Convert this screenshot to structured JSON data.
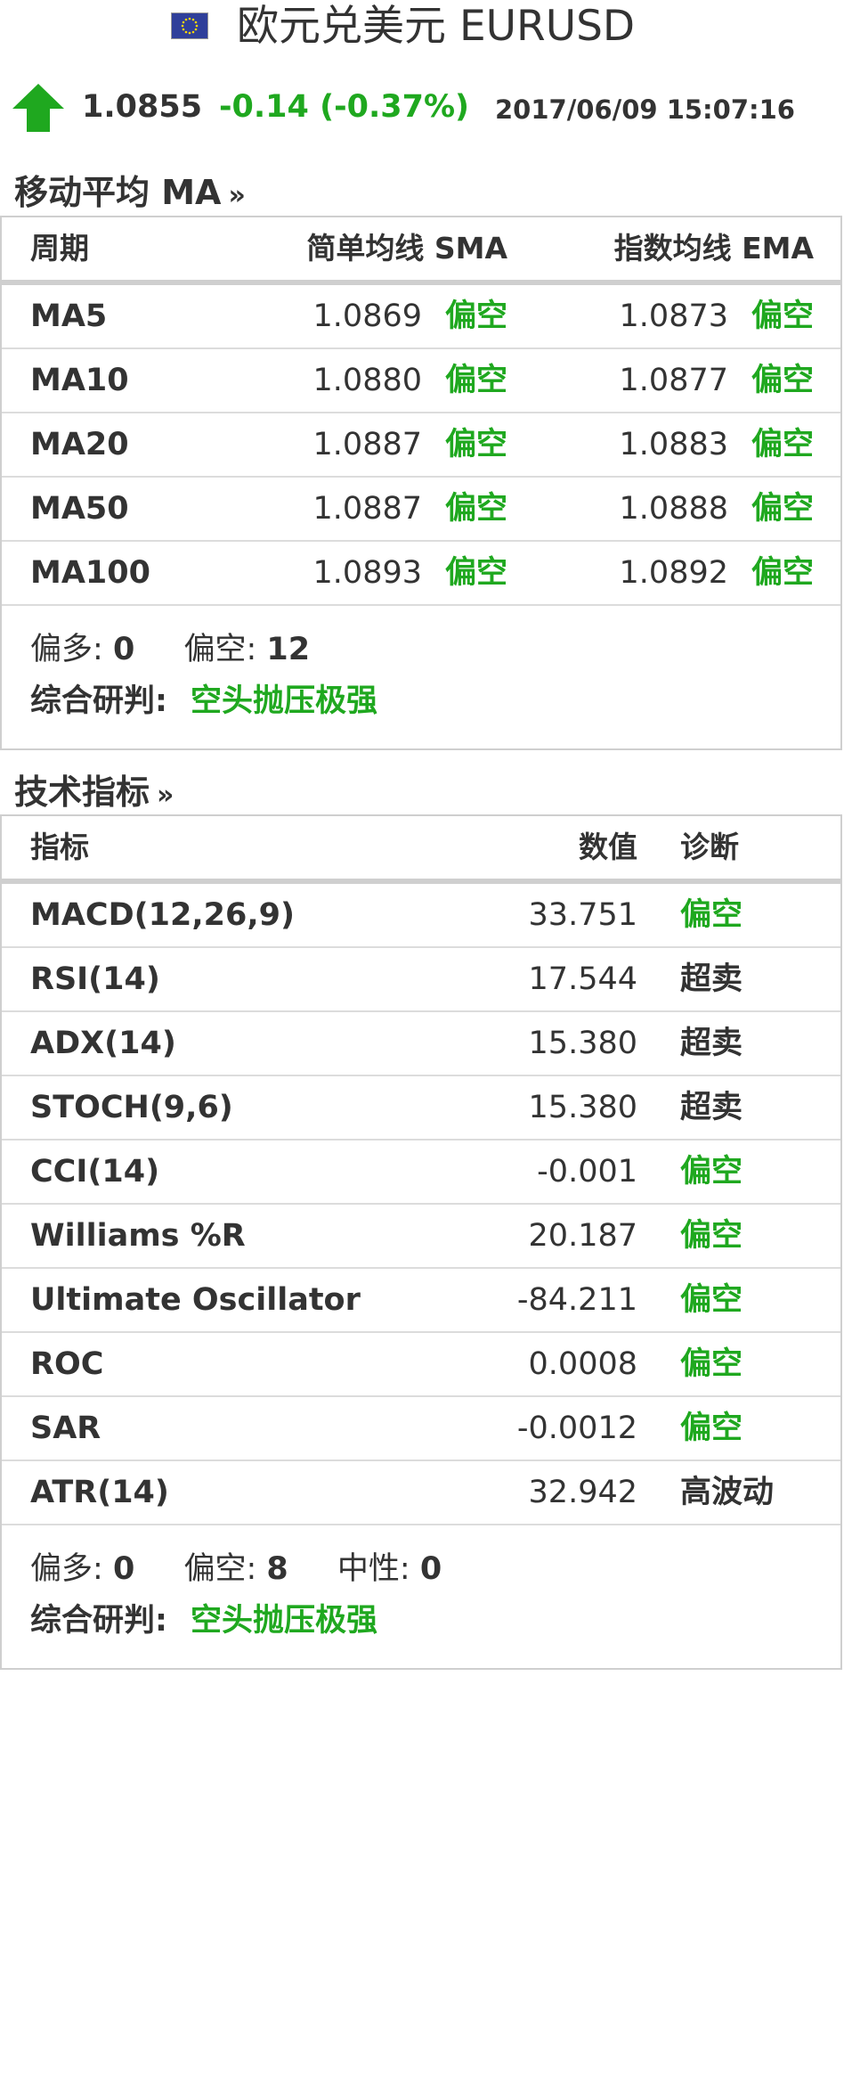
{
  "header": {
    "title": "欧元兑美元 EURUSD",
    "flag_icon": "eu-flag-icon"
  },
  "quote": {
    "trend_icon": "arrow-up-icon",
    "price": "1.0855",
    "change": "-0.14 (-0.37%)",
    "timestamp": "2017/06/09 15:07:16"
  },
  "colors": {
    "bullish_up_arrow": "#1fa81f",
    "text": "#333333",
    "border": "#cfcfcf"
  },
  "ma": {
    "section_title": "移动平均 MA",
    "more_icon": "»",
    "headers": {
      "period": "周期",
      "sma": "简单均线 SMA",
      "ema": "指数均线 EMA"
    },
    "rows": [
      {
        "period": "MA5",
        "sma": "1.0869",
        "sma_signal": "偏空",
        "ema": "1.0873",
        "ema_signal": "偏空"
      },
      {
        "period": "MA10",
        "sma": "1.0880",
        "sma_signal": "偏空",
        "ema": "1.0877",
        "ema_signal": "偏空"
      },
      {
        "period": "MA20",
        "sma": "1.0887",
        "sma_signal": "偏空",
        "ema": "1.0883",
        "ema_signal": "偏空"
      },
      {
        "period": "MA50",
        "sma": "1.0887",
        "sma_signal": "偏空",
        "ema": "1.0888",
        "ema_signal": "偏空"
      },
      {
        "period": "MA100",
        "sma": "1.0893",
        "sma_signal": "偏空",
        "ema": "1.0892",
        "ema_signal": "偏空"
      }
    ],
    "summary": {
      "bull_label": "偏多:",
      "bull_count": "0",
      "bear_label": "偏空:",
      "bear_count": "12",
      "verdict_label": "综合研判:",
      "verdict": "空头抛压极强"
    }
  },
  "tech": {
    "section_title": "技术指标",
    "more_icon": "»",
    "headers": {
      "indicator": "指标",
      "value": "数值",
      "diagnosis": "诊断"
    },
    "rows": [
      {
        "indicator": "MACD(12,26,9)",
        "value": "33.751",
        "diagnosis": "偏空",
        "green": true
      },
      {
        "indicator": "RSI(14)",
        "value": "17.544",
        "diagnosis": "超卖",
        "green": false
      },
      {
        "indicator": "ADX(14)",
        "value": "15.380",
        "diagnosis": "超卖",
        "green": false
      },
      {
        "indicator": "STOCH(9,6)",
        "value": "15.380",
        "diagnosis": "超卖",
        "green": false
      },
      {
        "indicator": "CCI(14)",
        "value": "-0.001",
        "diagnosis": "偏空",
        "green": true
      },
      {
        "indicator": "Williams %R",
        "value": "20.187",
        "diagnosis": "偏空",
        "green": true
      },
      {
        "indicator": "Ultimate Oscillator",
        "value": "-84.211",
        "diagnosis": "偏空",
        "green": true
      },
      {
        "indicator": "ROC",
        "value": "0.0008",
        "diagnosis": "偏空",
        "green": true
      },
      {
        "indicator": "SAR",
        "value": "-0.0012",
        "diagnosis": "偏空",
        "green": true
      },
      {
        "indicator": "ATR(14)",
        "value": "32.942",
        "diagnosis": "高波动",
        "green": false
      }
    ],
    "summary": {
      "bull_label": "偏多:",
      "bull_count": "0",
      "bear_label": "偏空:",
      "bear_count": "8",
      "neutral_label": "中性:",
      "neutral_count": "0",
      "verdict_label": "综合研判:",
      "verdict": "空头抛压极强"
    }
  }
}
